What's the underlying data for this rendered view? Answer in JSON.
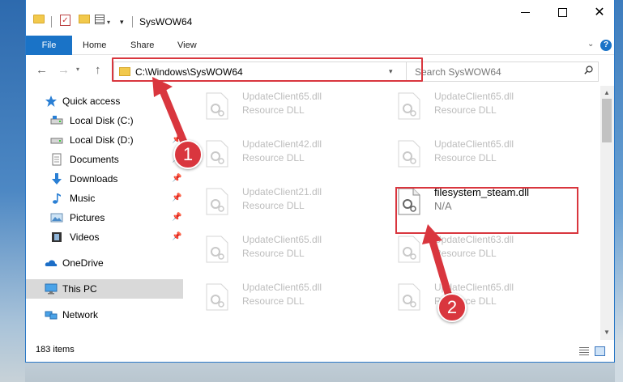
{
  "window": {
    "title": "SysWOW64",
    "colors": {
      "accent": "#1a73c7",
      "highlight": "#d9363e",
      "selection": "#d9d9d9"
    }
  },
  "ribbon": {
    "tabs": [
      "File",
      "Home",
      "Share",
      "View"
    ],
    "help": "?"
  },
  "address": {
    "path": "C:\\Windows\\SysWOW64"
  },
  "search": {
    "placeholder": "Search SysWOW64"
  },
  "nav": {
    "items": [
      {
        "label": "Quick access",
        "icon": "star-icon"
      },
      {
        "label": "Local Disk (C:)",
        "icon": "drive-icon"
      },
      {
        "label": "Local Disk (D:)",
        "icon": "drive-icon"
      },
      {
        "label": "Documents",
        "icon": "documents-icon"
      },
      {
        "label": "Downloads",
        "icon": "download-icon"
      },
      {
        "label": "Music",
        "icon": "music-icon"
      },
      {
        "label": "Pictures",
        "icon": "pictures-icon"
      },
      {
        "label": "Videos",
        "icon": "videos-icon"
      },
      {
        "label": "OneDrive",
        "icon": "cloud-icon"
      },
      {
        "label": "This PC",
        "icon": "pc-icon"
      },
      {
        "label": "Network",
        "icon": "network-icon"
      }
    ]
  },
  "files": [
    {
      "name": "UpdateClient65.dll",
      "type": "Resource DLL"
    },
    {
      "name": "UpdateClient65.dll",
      "type": "Resource DLL"
    },
    {
      "name": "UpdateClient42.dll",
      "type": "Resource DLL"
    },
    {
      "name": "UpdateClient65.dll",
      "type": "Resource DLL"
    },
    {
      "name": "UpdateClient21.dll",
      "type": "Resource DLL"
    },
    {
      "name": "filesystem_steam.dll",
      "type": "N/A"
    },
    {
      "name": "UpdateClient65.dll",
      "type": "Resource DLL"
    },
    {
      "name": "UpdateClient63.dll",
      "type": "Resource DLL"
    },
    {
      "name": "UpdateClient65.dll",
      "type": "Resource DLL"
    },
    {
      "name": "UpdateClient65.dll",
      "type": "Resource DLL"
    }
  ],
  "status": {
    "item_count": "183 items"
  },
  "annotations": {
    "step1": "1",
    "step2": "2"
  }
}
